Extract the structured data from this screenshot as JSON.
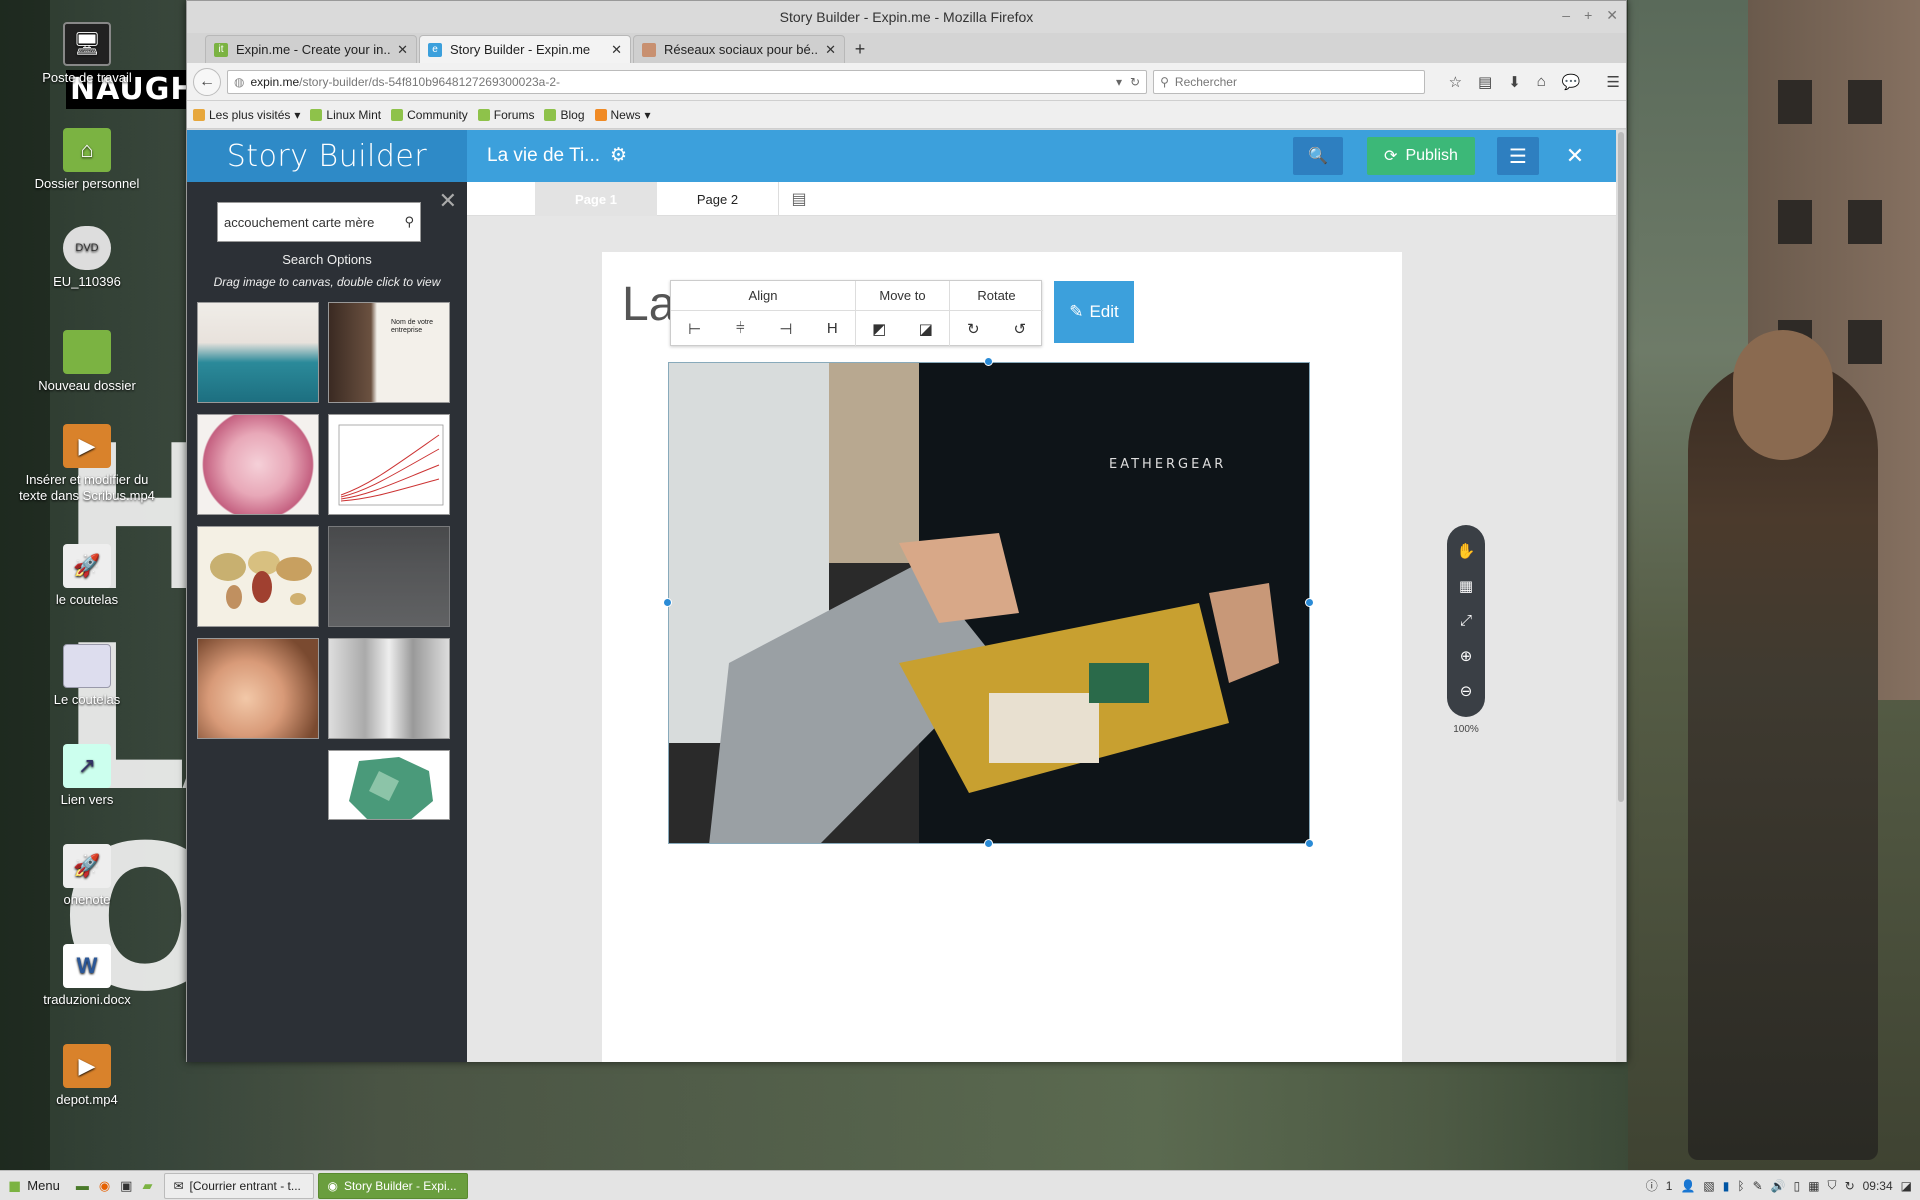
{
  "desktop": {
    "art_text": "NAUGH",
    "icons": [
      {
        "label": "Poste de travail"
      },
      {
        "label": "Dossier personnel"
      },
      {
        "label": "EU_110396"
      },
      {
        "label": "Nouveau dossier"
      },
      {
        "label": "Insérer et modifier du texte dans Scribus.mp4"
      },
      {
        "label": "le coutelas"
      },
      {
        "label": "Le coutelas"
      },
      {
        "label": "Lien vers"
      },
      {
        "label": "onenote"
      },
      {
        "label": "traduzioni.docx"
      },
      {
        "label": "depot.mp4"
      }
    ]
  },
  "browser": {
    "window_title": "Story Builder - Expin.me - Mozilla Firefox",
    "tabs": [
      {
        "label": "Expin.me - Create your in..."
      },
      {
        "label": "Story Builder - Expin.me"
      },
      {
        "label": "Réseaux sociaux pour bé..."
      }
    ],
    "url_host": "expin.me",
    "url_path": "/story-builder/ds-54f810b9648127269300023a-2-",
    "search_placeholder": "Rechercher",
    "bookmarks": [
      {
        "label": "Les plus visités"
      },
      {
        "label": "Linux Mint"
      },
      {
        "label": "Community"
      },
      {
        "label": "Forums"
      },
      {
        "label": "Blog"
      },
      {
        "label": "News"
      }
    ]
  },
  "app": {
    "logo": "Story Builder",
    "story_title": "La vie de Ti...",
    "publish_label": "Publish",
    "search_query": "accouchement carte mère",
    "search_options": "Search Options",
    "hint": "Drag image to canvas, double click to view",
    "page_tabs": [
      "Page 1",
      "Page 2"
    ],
    "sheet_title": "La",
    "toolbox": {
      "align": "Align",
      "move_to": "Move to",
      "rotate": "Rotate"
    },
    "edit_label": "Edit",
    "zoom_level": "100%",
    "thumb_card_title": "Nom de votre entreprise",
    "photo_shirt_text": "EATHERGEAR"
  },
  "taskbar": {
    "menu_label": "Menu",
    "tasks": [
      {
        "label": "[Courrier entrant - t..."
      },
      {
        "label": "Story Builder - Expi..."
      }
    ],
    "clock": "09:34",
    "counter": "1"
  },
  "colors": {
    "header_blue": "#3ca0dc",
    "publish_green": "#3cb878",
    "panel_dark": "#2c3036"
  }
}
